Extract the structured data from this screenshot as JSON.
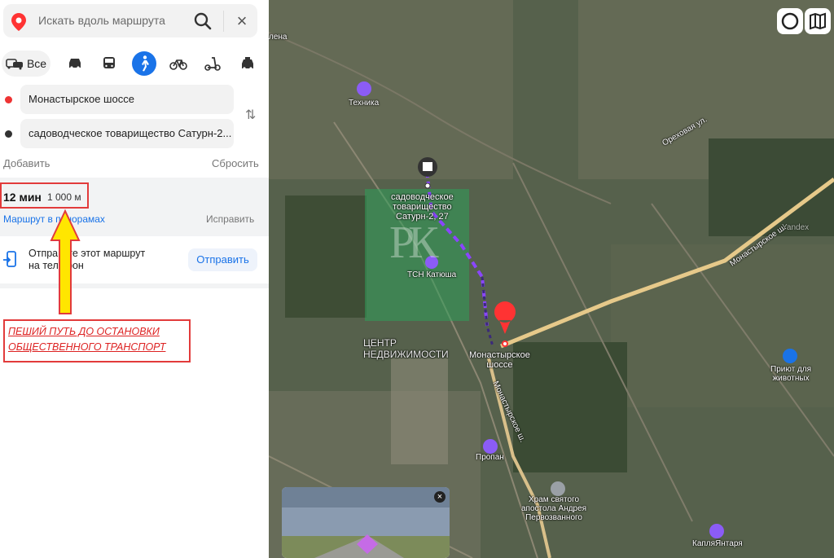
{
  "search": {
    "placeholder": "Искать вдоль маршрута"
  },
  "modes": {
    "all_label": "Все"
  },
  "route": {
    "from": "Монастырское шоссе",
    "to": "садоводческое товарищество Сатурн-2...",
    "add_label": "Добавить",
    "reset_label": "Сбросить",
    "time": "12 мин",
    "distance": "1 000 м",
    "panorama_link": "Маршрут в панорамах",
    "fix_link": "Исправить"
  },
  "send": {
    "text": "Отправьте этот маршрут на телефон",
    "button": "Отправить"
  },
  "annotation": {
    "line1": "ПЕШИЙ ПУТЬ ДО ОСТАНОВКИ",
    "line2": "ОБЩЕСТВЕННОГО ТРАНСПОРТ"
  },
  "map": {
    "labels": {
      "elena": "лена",
      "tekhnika": "Техника",
      "dest_1": "садоводческое",
      "dest_2": "товарищество",
      "dest_3": "Сатурн-2, 27",
      "tsn": "ТСН Катюша",
      "centre_1": "ЦЕНТР",
      "centre_2": "НЕДВИЖИМОСТИ",
      "start_1": "Монастырское",
      "start_2": "шоссе",
      "propan": "Пропан",
      "khram_1": "Храм святого",
      "khram_2": "апостола Андрея",
      "khram_3": "Первозванного",
      "priyut_1": "Приют для",
      "priyut_2": "животных",
      "kaplya": "КапляЯнтаря",
      "yandex": "Yandex",
      "road_mon": "Монастырское ш.",
      "road_orekh": "Ореховая ул.",
      "road_mon2": "Монастырское ш."
    },
    "watermark": "РК"
  },
  "colors": {
    "accent": "#1a73e8",
    "annotation_red": "#e23b3b",
    "arrow_yellow": "#ffe600",
    "route_purple": "#8a45ff",
    "map_dark": "#55604b"
  }
}
